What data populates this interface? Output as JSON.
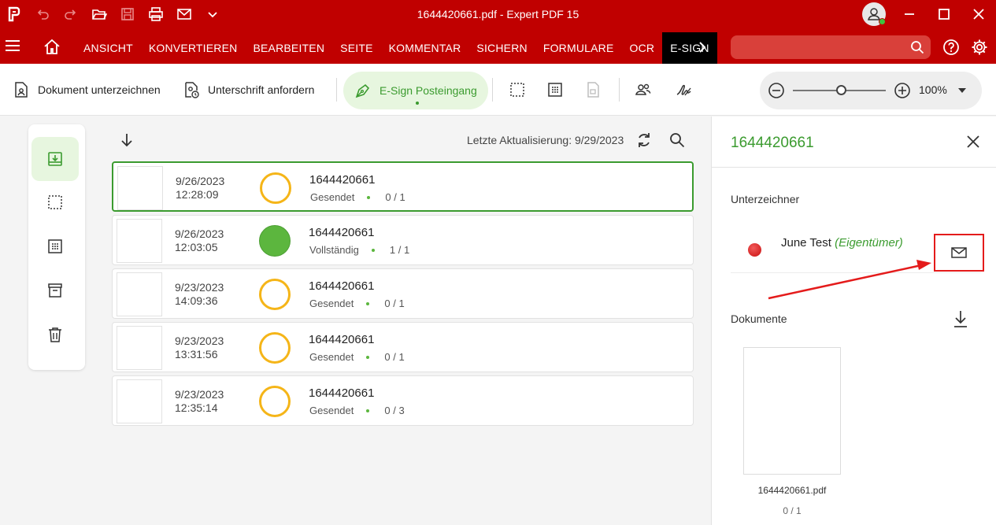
{
  "titlebar": {
    "title": "1644420661.pdf  -  Expert PDF 15",
    "icons": [
      "app-logo-icon",
      "undo-icon",
      "redo-icon",
      "open-folder-icon",
      "save-icon",
      "print-icon",
      "mail-icon",
      "chevron-down-icon"
    ],
    "window_controls": [
      "minimize-icon",
      "maximize-icon",
      "close-icon"
    ]
  },
  "menubar": {
    "tabs": [
      "ANSICHT",
      "KONVERTIEREN",
      "BEARBEITEN",
      "SEITE",
      "KOMMENTAR",
      "SICHERN",
      "FORMULARE",
      "OCR",
      "E-SIGN"
    ],
    "active_tab": "E-SIGN",
    "search_placeholder": ""
  },
  "toolbar": {
    "sign_document": "Dokument unterzeichnen",
    "request_signature": "Unterschrift anfordern",
    "esign_inbox": "E-Sign Posteingang",
    "zoom": "100%"
  },
  "list": {
    "last_update": "Letzte Aktualisierung: 9/29/2023",
    "rows": [
      {
        "date": "9/26/2023",
        "time": "12:28:09",
        "name": "1644420661",
        "status": "Gesendet",
        "progress": "0 / 1",
        "state": "pending"
      },
      {
        "date": "9/26/2023",
        "time": "12:03:05",
        "name": "1644420661",
        "status": "Vollständig",
        "progress": "1 / 1",
        "state": "done"
      },
      {
        "date": "9/23/2023",
        "time": "14:09:36",
        "name": "1644420661",
        "status": "Gesendet",
        "progress": "0 / 1",
        "state": "pending"
      },
      {
        "date": "9/23/2023",
        "time": "13:31:56",
        "name": "1644420661",
        "status": "Gesendet",
        "progress": "0 / 1",
        "state": "pending"
      },
      {
        "date": "9/23/2023",
        "time": "12:35:14",
        "name": "1644420661",
        "status": "Gesendet",
        "progress": "0 / 3",
        "state": "pending"
      }
    ]
  },
  "panel": {
    "title": "1644420661",
    "signers_label": "Unterzeichner",
    "signer_name": "June Test",
    "signer_role": "(Eigentümer)",
    "documents_label": "Dokumente",
    "document_name": "1644420661.pdf",
    "document_count": "0 / 1"
  },
  "colors": {
    "brand_red": "#c00000",
    "accent_green": "#3b9b2f",
    "pending_yellow": "#f5b518",
    "annotation_red": "#e41b1b"
  }
}
